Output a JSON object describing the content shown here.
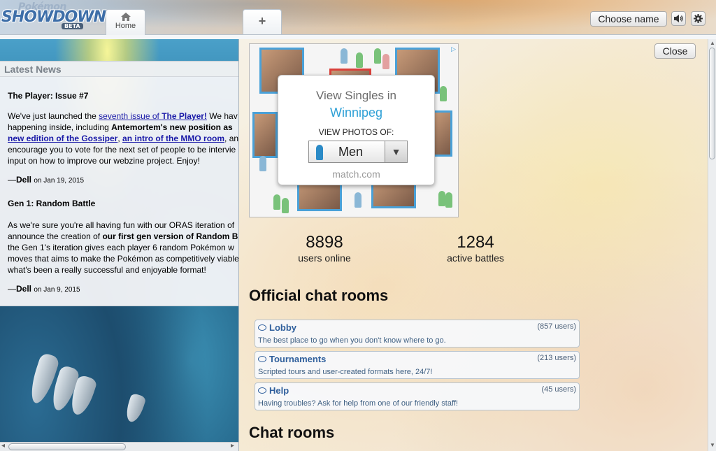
{
  "header": {
    "logo_top": "Pokémon",
    "logo_main": "SHOWDOWN",
    "logo_badge": "BETA",
    "tabs": [
      {
        "label": "Home",
        "icon": "home-icon"
      },
      {
        "label": "+",
        "icon": "plus-icon"
      }
    ],
    "choose_name_label": "Choose name",
    "sound_icon": "speaker-icon",
    "settings_icon": "gear-icon"
  },
  "news": {
    "heading": "Latest News",
    "items": [
      {
        "title": "The Player: Issue #7",
        "line1_pre": "We've just launched the ",
        "line1_link1": "seventh issue of ",
        "line1_link2": "The Player!",
        "line1_post": " We hav",
        "line2_pre": "happening inside, including ",
        "line2_bold": "Antemortem's new position as",
        "line3_link1": "new edition of the Gossiper",
        "line3_mid": ", ",
        "line3_link2": "an intro of the MMO room",
        "line3_post": ", and",
        "line4": "encourage you to vote for the next set of people to be intervie",
        "line5": "input on how to improve our webzine project. Enjoy!",
        "sig_dash": "—",
        "author": "Dell",
        "date_prefix": "on ",
        "date": "Jan 19, 2015"
      },
      {
        "title": "Gen 1: Random Battle",
        "line1": "As we're sure you're all having fun with our ORAS iteration of",
        "line2_pre": "announce the creation of ",
        "line2_bold": "our first gen version of Random B",
        "line3": "the Gen 1's iteration gives each player 6 random Pokémon w",
        "line4": "moves that aims to make the Pokémon as competitively viable",
        "line5": "what's been a really successful and enjoyable format!",
        "sig_dash": "—",
        "author": "Dell",
        "date_prefix": "on ",
        "date": "Jan 9, 2015"
      }
    ]
  },
  "right": {
    "close_label": "Close",
    "ad": {
      "headline": "View Singles in",
      "city": "Winnipeg",
      "prompt": "VIEW PHOTOS OF:",
      "select_value": "Men",
      "brand": "match.com",
      "adchoices": "▷"
    },
    "stats": [
      {
        "value": "8898",
        "label": "users online"
      },
      {
        "value": "1284",
        "label": "active battles"
      }
    ],
    "official_title": "Official chat rooms",
    "rooms": [
      {
        "name": "Lobby",
        "users": "(857 users)",
        "desc": "The best place to go when you don't know where to go."
      },
      {
        "name": "Tournaments",
        "users": "(213 users)",
        "desc": "Scripted tours and user-created formats here, 24/7!"
      },
      {
        "name": "Help",
        "users": "(45 users)",
        "desc": "Having troubles? Ask for help from one of our friendly staff!"
      }
    ],
    "chat_title": "Chat rooms"
  }
}
